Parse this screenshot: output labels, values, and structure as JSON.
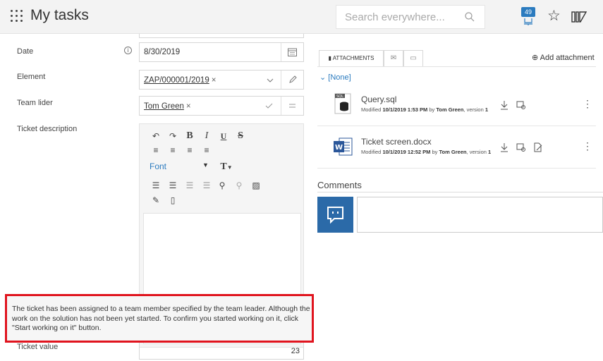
{
  "header": {
    "title": "My tasks",
    "search_placeholder": "Search everywhere...",
    "notification_count": "49"
  },
  "form": {
    "date_label": "Date",
    "date_value": "8/30/2019",
    "element_label": "Element",
    "element_value": "ZAP/000001/2019",
    "team_leader_label": "Team lider",
    "team_leader_value": "Tom Green",
    "description_label": "Ticket description",
    "ticket_value_label": "Ticket value",
    "ticket_value": "23"
  },
  "editor": {
    "font_label": "Font"
  },
  "attachments": {
    "tab_label": "ATTACHMENTS",
    "add_label": "Add attachment",
    "group_label": "[None]",
    "files": [
      {
        "name": "Query.sql",
        "modified_prefix": "Modified",
        "date": "10/1/2019 1:53 PM",
        "by": "by",
        "author": "Tom Green",
        "version_text": ", version",
        "version": "1"
      },
      {
        "name": "Ticket screen.docx",
        "modified_prefix": "Modified",
        "date": "10/1/2019 12:52 PM",
        "by": "by",
        "author": "Tom Green",
        "version_text": ", version",
        "version": "1"
      }
    ]
  },
  "comments": {
    "title": "Comments"
  },
  "tooltip": {
    "text": "The ticket has been assigned to a team member specified by the team leader. Although the work on the solution has not been yet started. To confirm you started working on it, click \"Start working on it\" button."
  },
  "colors": {
    "accent": "#2b7bbf",
    "highlight": "#e0141e",
    "avatar": "#2b6aa8"
  }
}
